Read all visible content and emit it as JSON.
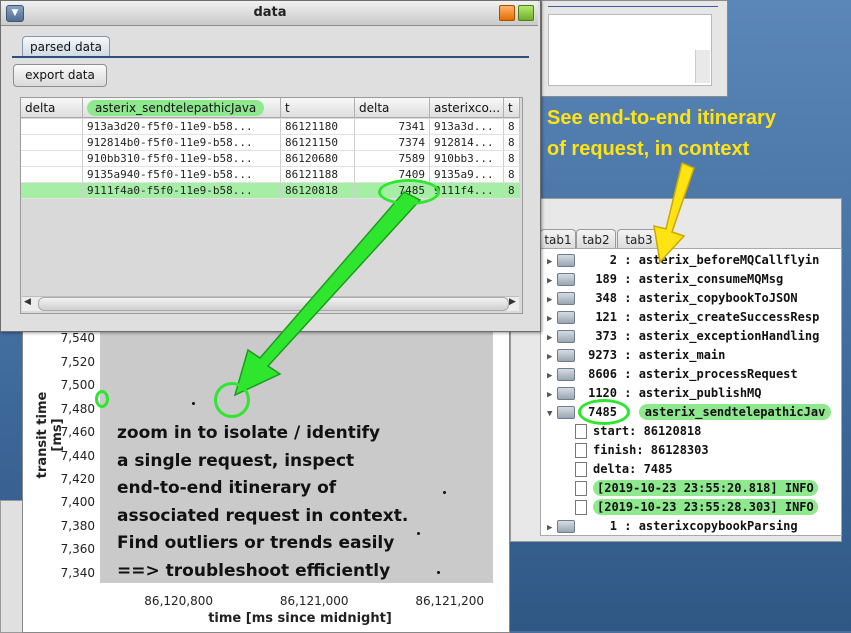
{
  "data_window": {
    "title": "data",
    "tab_label": "parsed data",
    "export_label": "export data",
    "columns": [
      "delta",
      "asterix_sendtelepathicJava",
      "t",
      "delta",
      "asterixco...",
      "t"
    ],
    "rows": [
      {
        "c0": "",
        "c1": "913a3d20-f5f0-11e9-b58...",
        "c2": "86121180",
        "c3": "7341",
        "c4": "913a3d...",
        "c5": "8"
      },
      {
        "c0": "",
        "c1": "912814b0-f5f0-11e9-b58...",
        "c2": "86121150",
        "c3": "7374",
        "c4": "912814...",
        "c5": "8"
      },
      {
        "c0": "",
        "c1": "910bb310-f5f0-11e9-b58...",
        "c2": "86120680",
        "c3": "7589",
        "c4": "910bb3...",
        "c5": "8"
      },
      {
        "c0": "",
        "c1": "9135a940-f5f0-11e9-b58...",
        "c2": "86121188",
        "c3": "7409",
        "c4": "9135a9...",
        "c5": "8"
      },
      {
        "c0": "",
        "c1": "9111f4a0-f5f0-11e9-b58...",
        "c2": "86120818",
        "c3": "7485",
        "c4": "9111f4...",
        "c5": "8"
      }
    ]
  },
  "tree_window": {
    "tabs": [
      "tab1",
      "tab2",
      "tab3"
    ],
    "items": [
      {
        "count": "2",
        "name": "asterix_beforeMQCallflyin"
      },
      {
        "count": "189",
        "name": "asterix_consumeMQMsg"
      },
      {
        "count": "348",
        "name": "asterix_copybookToJSON"
      },
      {
        "count": "121",
        "name": "asterix_createSuccessResp"
      },
      {
        "count": "373",
        "name": "asterix_exceptionHandling"
      },
      {
        "count": "9273",
        "name": "asterix_main"
      },
      {
        "count": "8606",
        "name": "asterix_processRequest"
      },
      {
        "count": "1120",
        "name": "asterix_publishMQ"
      },
      {
        "count": "7485",
        "name": "asterix_sendtelepathicJav"
      }
    ],
    "details": {
      "start": "start: 86120818",
      "finish": "finish: 86128303",
      "delta": "delta: 7485",
      "log1": "[2019-10-23 23:55:20.818] INFO",
      "log2": "[2019-10-23 23:55:28.303] INFO"
    },
    "last_item": {
      "count": "1",
      "name": "asterixcopybookParsing"
    }
  },
  "chart_data": {
    "type": "scatter",
    "xlabel": "time [ms since midnight]",
    "ylabel": "transit time [ms]",
    "x_ticks": [
      "86,120,800",
      "86,121,000",
      "86,121,200"
    ],
    "y_ticks": [
      "7,540",
      "7,520",
      "7,500",
      "7,480",
      "7,460",
      "7,440",
      "7,420",
      "7,400",
      "7,380",
      "7,360",
      "7,340"
    ],
    "xlim": [
      86120680,
      86121260
    ],
    "ylim": [
      7332,
      7548
    ],
    "points": [
      {
        "x": 86120818,
        "y": 7485
      },
      {
        "x": 86121180,
        "y": 7341
      },
      {
        "x": 86121150,
        "y": 7374
      },
      {
        "x": 86121188,
        "y": 7409
      }
    ]
  },
  "annotations": {
    "zoom_text": [
      "zoom in to isolate / identify",
      "a single request, inspect",
      "end-to-end itinerary of",
      "associated request in context.",
      "Find outliers or trends easily",
      "==> troubleshoot efficiently"
    ],
    "callout_text": [
      "See end-to-end itinerary",
      "of request, in context"
    ]
  },
  "colors": {
    "highlight": "#2ee62e",
    "callout": "#ffe312",
    "selection": "#a6eea6"
  }
}
